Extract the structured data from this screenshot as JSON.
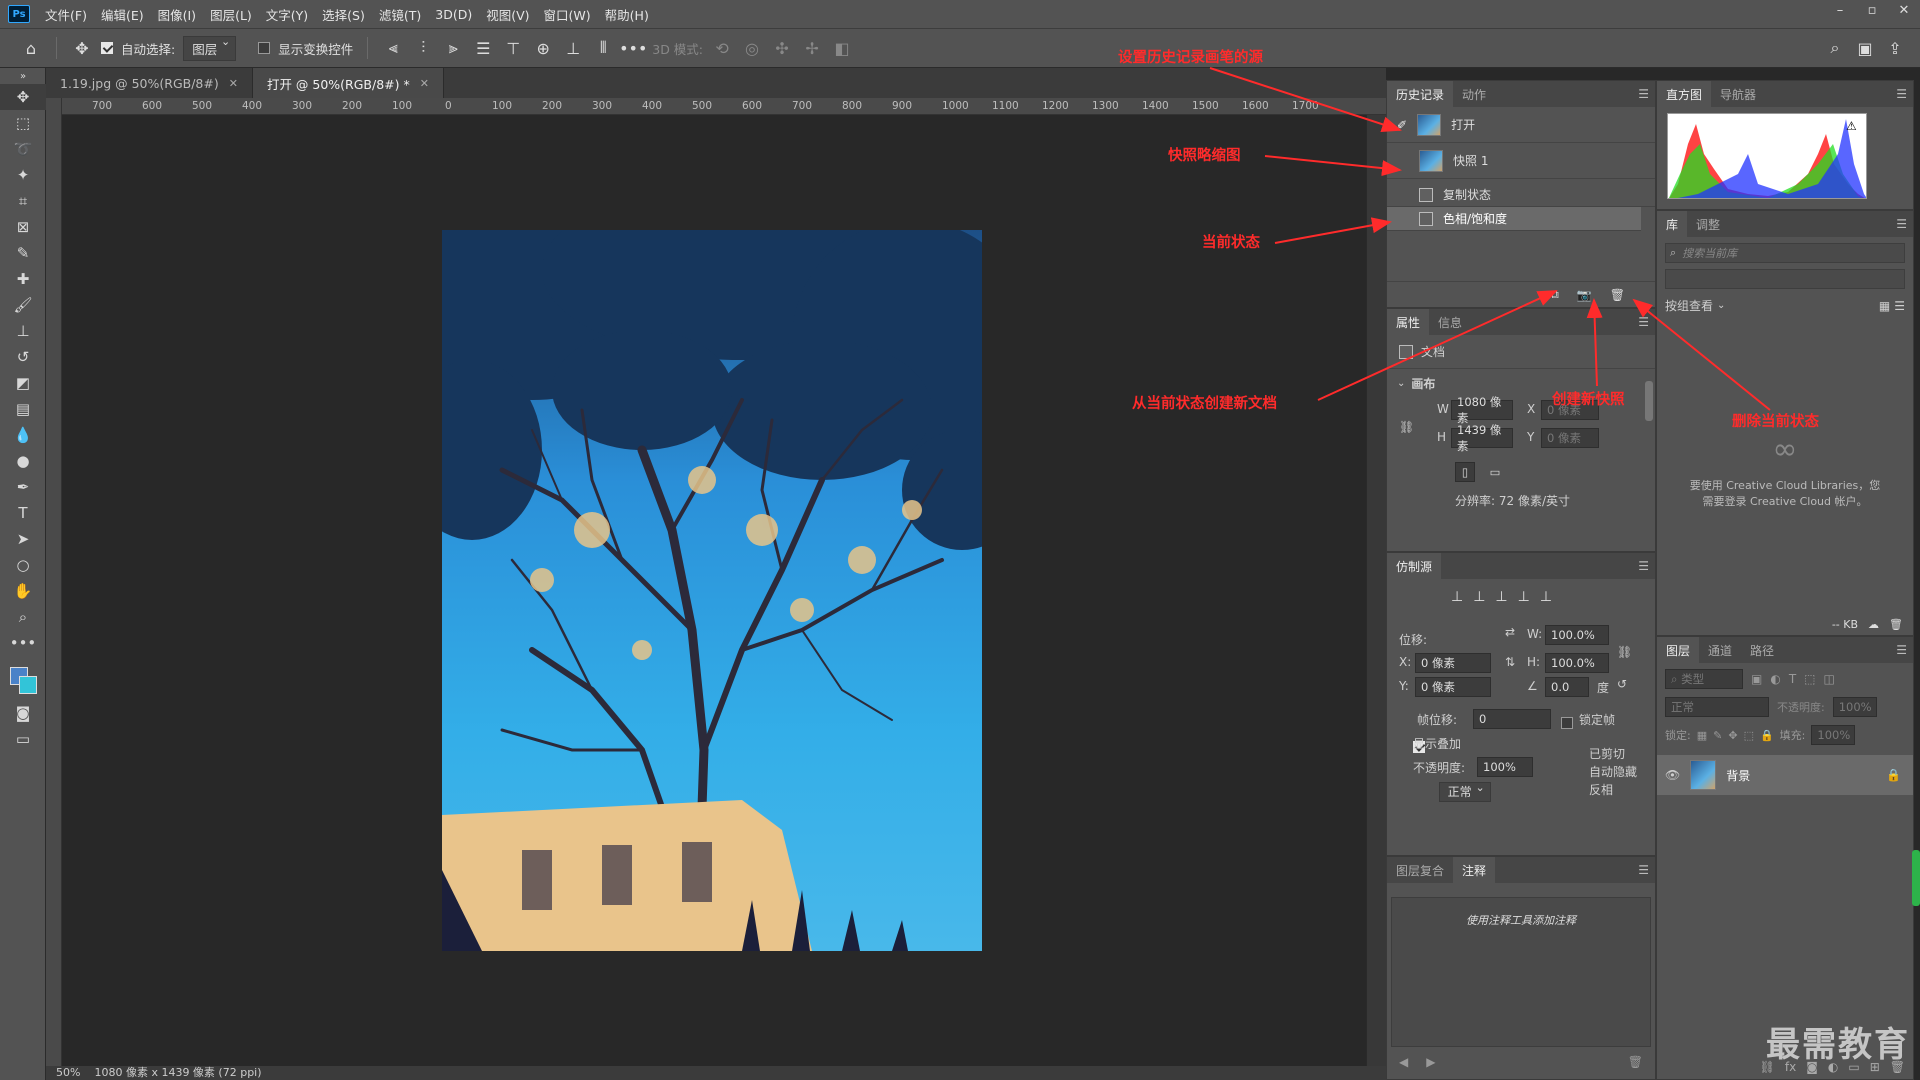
{
  "menu": [
    "文件(F)",
    "编辑(E)",
    "图像(I)",
    "图层(L)",
    "文字(Y)",
    "选择(S)",
    "滤镜(T)",
    "3D(D)",
    "视图(V)",
    "窗口(W)",
    "帮助(H)"
  ],
  "app_icon": "Ps",
  "options": {
    "auto_select_label": "自动选择:",
    "auto_select_value": "图层",
    "show_transform_label": "显示变换控件",
    "mode_3d_label": "3D 模式:"
  },
  "doc_tabs": [
    {
      "label": "1.19.jpg @ 50%(RGB/8#)",
      "active": false
    },
    {
      "label": "打开 @ 50%(RGB/8#) *",
      "active": true
    }
  ],
  "ruler_ticks": [
    "700",
    "600",
    "500",
    "400",
    "300",
    "200",
    "100",
    "0",
    "100",
    "200",
    "300",
    "400",
    "500",
    "600",
    "700",
    "800",
    "900",
    "1000",
    "1100",
    "1200",
    "1300",
    "1400",
    "1500",
    "1600",
    "1700"
  ],
  "status": {
    "zoom": "50%",
    "info": "1080 像素 x 1439 像素 (72 ppi)"
  },
  "history_panel": {
    "tabs": [
      "历史记录",
      "动作"
    ],
    "snapshots": [
      {
        "label": "打开",
        "thumb": true
      },
      {
        "label": "快照 1",
        "thumb": true
      }
    ],
    "states": [
      {
        "label": "复制状态",
        "selected": false
      },
      {
        "label": "色相/饱和度",
        "selected": true
      }
    ]
  },
  "properties_panel": {
    "tabs": [
      "属性",
      "信息"
    ],
    "doc_label": "文档",
    "canvas_label": "画布",
    "w_label": "W",
    "w_value": "1080 像素",
    "h_label": "H",
    "h_value": "1439 像素",
    "x_label": "X",
    "x_value": "0 像素",
    "y_label": "Y",
    "y_value": "0 像素",
    "resolution": "分辨率: 72 像素/英寸"
  },
  "clone_panel": {
    "tab": "仿制源",
    "offset_label": "位移:",
    "x_label": "X:",
    "x_value": "0 像素",
    "y_label": "Y:",
    "y_value": "0 像素",
    "w_label": "W:",
    "w_value": "100.0%",
    "h_label": "H:",
    "h_value": "100.0%",
    "angle_value": "0.0",
    "angle_unit": "度",
    "frame_offset_label": "帧位移:",
    "frame_offset_value": "0",
    "lock_frame_label": "锁定帧",
    "show_overlay_label": "显示叠加",
    "opacity_label": "不透明度:",
    "opacity_value": "100%",
    "blend_value": "正常",
    "clipped_label": "已剪切",
    "auto_hide_label": "自动隐藏",
    "invert_label": "反相"
  },
  "notes_panel": {
    "tabs": [
      "图层复合",
      "注释"
    ],
    "hint": "使用注释工具添加注释"
  },
  "histogram_panel": {
    "tabs": [
      "直方图",
      "导航器"
    ]
  },
  "library_panel": {
    "tabs": [
      "库",
      "调整"
    ],
    "search_placeholder": "搜索当前库",
    "view_label": "按组查看",
    "message_line1": "要使用 Creative Cloud Libraries，您",
    "message_line2": "需要登录 Creative Cloud 帐户。",
    "size": "-- KB"
  },
  "layers_panel": {
    "tabs": [
      "图层",
      "通道",
      "路径"
    ],
    "filter_placeholder": "类型",
    "blend_value": "正常",
    "opacity_label": "不透明度:",
    "opacity_value": "100%",
    "lock_label": "锁定:",
    "fill_label": "填充:",
    "fill_value": "100%",
    "layer_name": "背景"
  },
  "annotations": [
    "设置历史记录画笔的源",
    "快照略缩图",
    "当前状态",
    "从当前状态创建新文档",
    "创建新快照",
    "删除当前状态"
  ],
  "annotation_color": "#ff2b2b",
  "watermark": "最需教育"
}
